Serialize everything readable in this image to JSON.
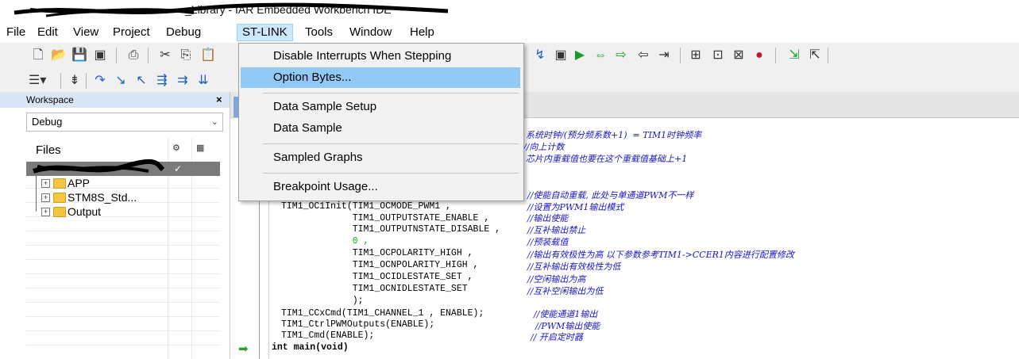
{
  "window": {
    "title": "_Library - IAR Embedded Workbench IDE"
  },
  "menubar": {
    "items": [
      "File",
      "Edit",
      "View",
      "Project",
      "Debug",
      "ST-LINK",
      "Tools",
      "Window",
      "Help"
    ],
    "active": "ST-LINK"
  },
  "st_link_menu": {
    "items": [
      {
        "label": "Disable Interrupts When Stepping",
        "highlighted": false
      },
      {
        "label": "Option Bytes...",
        "highlighted": true
      },
      {
        "label": "Data Sample Setup",
        "highlighted": false
      },
      {
        "label": "Data Sample",
        "highlighted": false
      },
      {
        "label": "Sampled Graphs",
        "highlighted": false
      },
      {
        "label": "Breakpoint Usage...",
        "highlighted": false
      }
    ]
  },
  "workspace": {
    "title": "Workspace",
    "close": "×",
    "configuration": "Debug",
    "files_header": "Files",
    "project_check": "✓",
    "tree": [
      {
        "name": "APP",
        "expander": "+"
      },
      {
        "name": "STM8S_Std...",
        "expander": "+"
      },
      {
        "name": "Output",
        "expander": "+"
      }
    ]
  },
  "editor": {
    "code_lines": [
      "TIM1_OC1Init(TIM1_OCMODE_PWM1 ,",
      "             TIM1_OUTPUTSTATE_ENABLE ,",
      "             TIM1_OUTPUTNSTATE_DISABLE ,",
      "             0 ,",
      "             TIM1_OCPOLARITY_HIGH ,",
      "             TIM1_OCNPOLARITY_HIGH ,",
      "             TIM1_OCIDLESTATE_SET ,",
      "             TIM1_OCNIDLESTATE_SET",
      "             );",
      "TIM1_CCxCmd(TIM1_CHANNEL_1 , ENABLE);",
      "TIM1_CtrlPWMOutputs(ENABLE);",
      "TIM1_Cmd(ENABLE);",
      "int main(void)"
    ],
    "comments": [
      "系统时钟/(预分频系数+1)  = TIM1时钟频率",
      "//向上计数",
      "芯片内重载值也要在这个重载值基础上+1",
      "//使能自动重载, 此处与单通道PWM不一样",
      "//设置为PWM1输出模式",
      "//输出使能",
      "//互补输出禁止",
      "//预装载值",
      "//输出有效极性为高 以下参数参考TIM1->CCER1内容进行配置修改",
      "//互补输出有效极性为低",
      "//空闲输出为高",
      "//互补空闲输出为低",
      "//使能通道1输出",
      "//PWM输出使能",
      "// 开启定时器"
    ]
  }
}
